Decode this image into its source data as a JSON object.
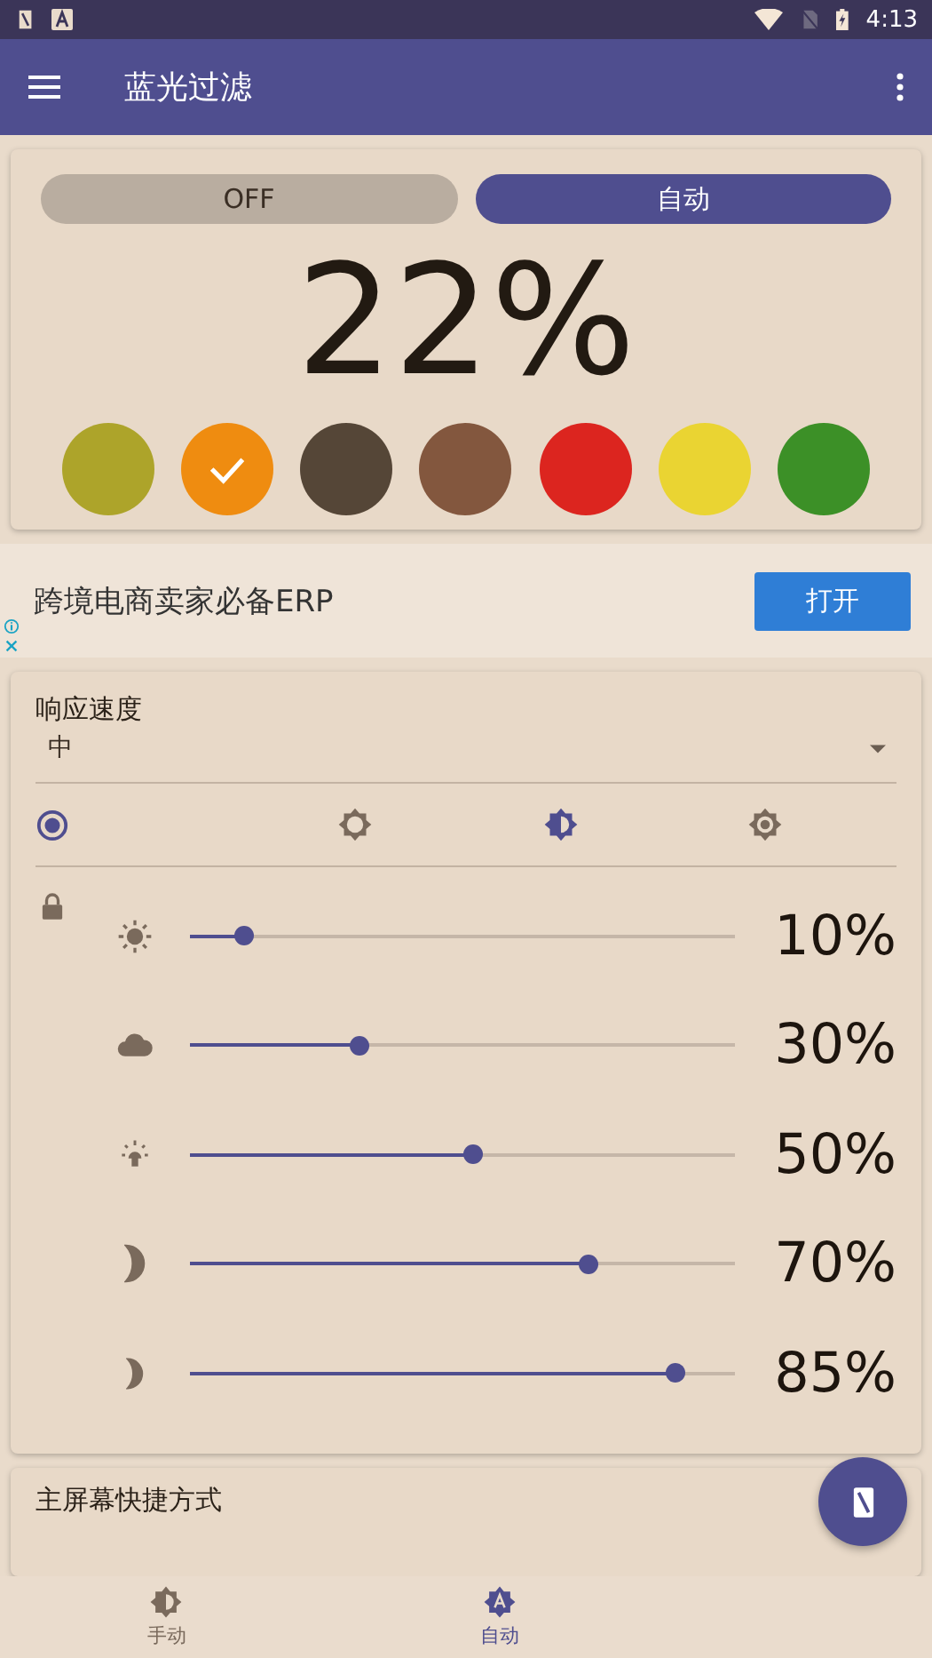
{
  "status_bar": {
    "time": "4:13"
  },
  "app_bar": {
    "title": "蓝光过滤"
  },
  "toggle": [
    {
      "label": "OFF",
      "selected": false
    },
    {
      "label": "自动",
      "selected": true
    }
  ],
  "intensity": "22%",
  "swatches": [
    {
      "color": "#ada42a",
      "selected": false
    },
    {
      "color": "#ef8c10",
      "selected": true
    },
    {
      "color": "#554637",
      "selected": false
    },
    {
      "color": "#83573e",
      "selected": false
    },
    {
      "color": "#dc251f",
      "selected": false
    },
    {
      "color": "#ead432",
      "selected": false
    },
    {
      "color": "#3c9027",
      "selected": false
    }
  ],
  "ad": {
    "text": "跨境电商卖家必备ERP",
    "button": "打开"
  },
  "response_speed": {
    "label": "响应速度",
    "value": "中"
  },
  "mode_row": {
    "radio_checked": true,
    "options": [
      {
        "selected": false
      },
      {
        "selected": true
      },
      {
        "selected": false
      }
    ]
  },
  "locked": true,
  "levels": [
    {
      "level": 0.1,
      "reading": "10%"
    },
    {
      "level": 0.31,
      "reading": "30%"
    },
    {
      "level": 0.52,
      "reading": "50%"
    },
    {
      "level": 0.73,
      "reading": "70%"
    },
    {
      "level": 0.89,
      "reading": "85%"
    }
  ],
  "shortcut_card": {
    "title": "主屏幕快捷方式"
  },
  "bottom_nav": [
    {
      "label": "手动",
      "selected": false
    },
    {
      "label": "自动",
      "selected": true
    }
  ]
}
